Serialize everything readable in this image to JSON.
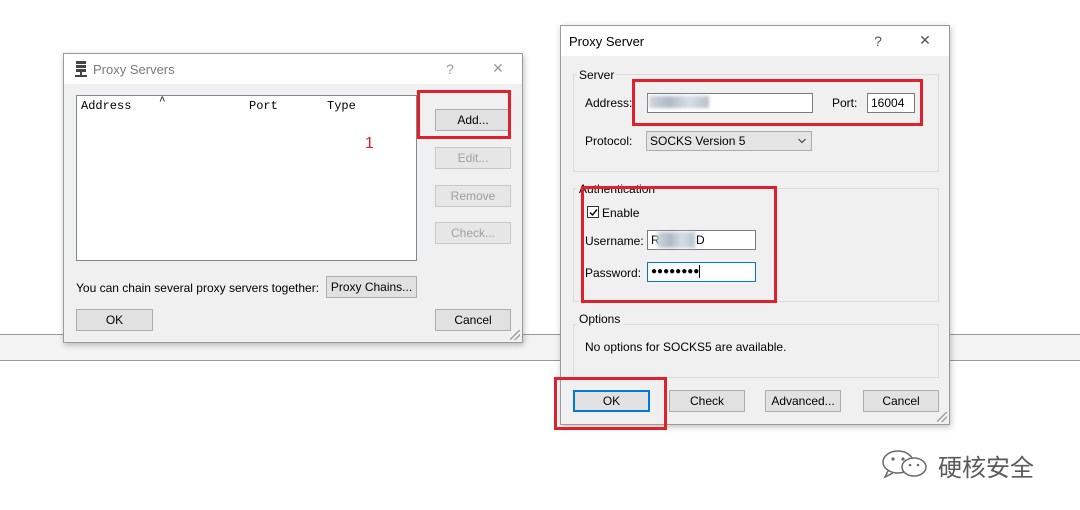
{
  "proxy_servers": {
    "title": "Proxy Servers",
    "help": "?",
    "close": "✕",
    "columns": [
      "Address",
      "Port",
      "Type"
    ],
    "sort_indicator": "^",
    "buttons": {
      "add": "Add...",
      "edit": "Edit...",
      "remove": "Remove",
      "check": "Check..."
    },
    "chain_text": "You can chain several proxy servers together:",
    "proxy_chains": "Proxy Chains...",
    "ok": "OK",
    "cancel": "Cancel"
  },
  "annotation_step": "1",
  "proxy_server": {
    "title": "Proxy Server",
    "help": "?",
    "close": "✕",
    "server_group": "Server",
    "address_label": "Address:",
    "address_value": "",
    "port_label": "Port:",
    "port_value": "16004",
    "protocol_label": "Protocol:",
    "protocol_value": "SOCKS Version 5",
    "auth_group": "Authentication",
    "enable_label": "Enable",
    "enable_checked": true,
    "username_label": "Username:",
    "username_value_start": "R",
    "username_value_end": "D",
    "password_label": "Password:",
    "password_value": "●●●●●●●●",
    "options_group": "Options",
    "options_text": "No options for SOCKS5 are available.",
    "ok": "OK",
    "check": "Check",
    "advanced": "Advanced...",
    "cancel": "Cancel"
  },
  "watermark": {
    "text": "硬核安全",
    "icon": "wechat-icon"
  },
  "colors": {
    "highlight_red": "#e0202a",
    "focus_blue": "#0078d7",
    "dialog_bg": "#f0f0f0"
  }
}
